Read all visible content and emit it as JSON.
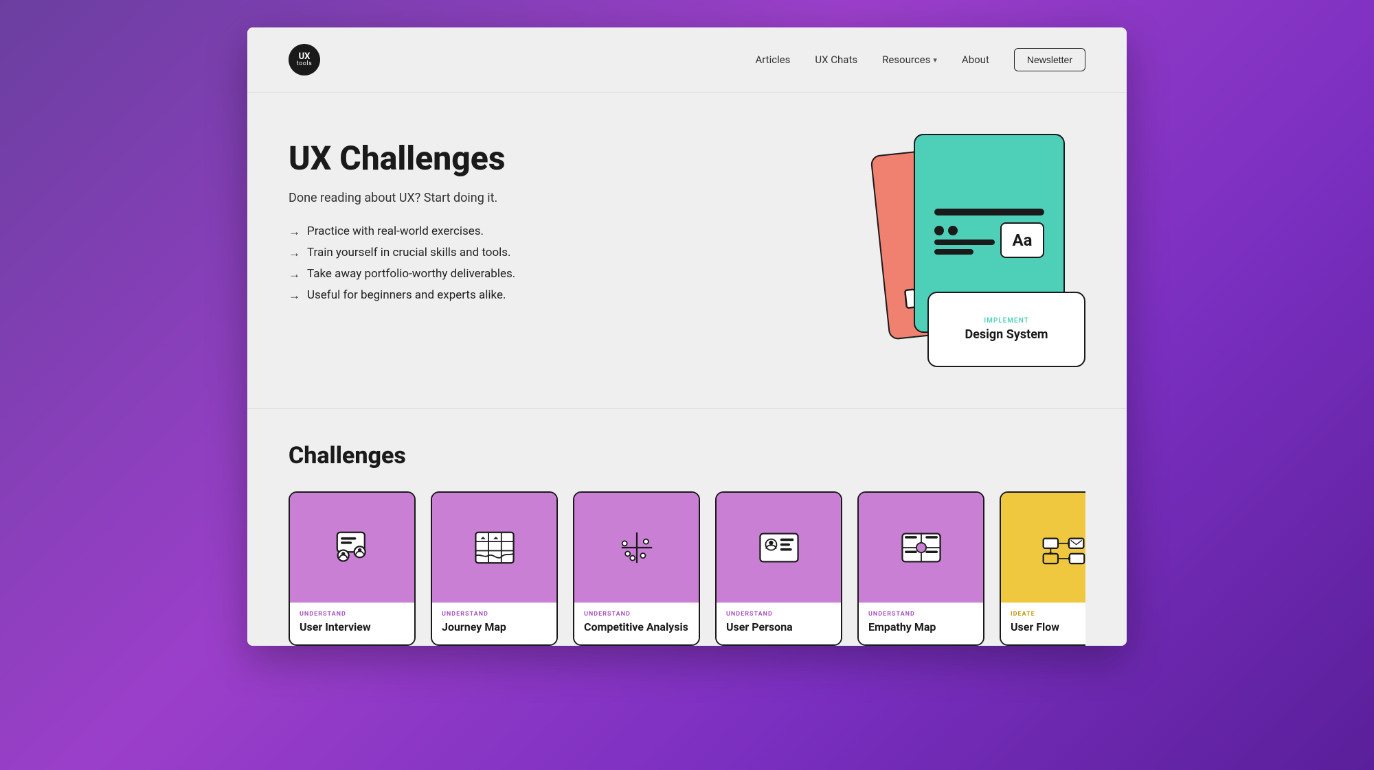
{
  "header": {
    "logo": {
      "ux": "UX",
      "tools": "tools"
    },
    "nav": {
      "articles": "Articles",
      "ux_chats": "UX Chats",
      "resources": "Resources",
      "about": "About",
      "newsletter": "Newsletter"
    }
  },
  "hero": {
    "title": "UX Challenges",
    "subtitle": "Done reading about UX? Start doing it.",
    "bullets": [
      "Practice with real-world exercises.",
      "Train yourself in crucial skills and tools.",
      "Take away portfolio-worthy deliverables.",
      "Useful for beginners and experts alike."
    ],
    "card_bottom_label": "IMPLEMENT",
    "card_bottom_title": "Design System"
  },
  "challenges": {
    "title": "Challenges",
    "cards": [
      {
        "id": 1,
        "color_class": "card-purple",
        "label": "UNDERSTAND",
        "label_color": "label-purple",
        "name": "User Interview"
      },
      {
        "id": 2,
        "color_class": "card-purple",
        "label": "UNDERSTAND",
        "label_color": "label-purple",
        "name": "Journey Map"
      },
      {
        "id": 3,
        "color_class": "card-purple",
        "label": "UNDERSTAND",
        "label_color": "label-purple",
        "name": "Competitive Analysis"
      },
      {
        "id": 4,
        "color_class": "card-purple",
        "label": "UNDERSTAND",
        "label_color": "label-purple",
        "name": "User Persona"
      },
      {
        "id": 5,
        "color_class": "card-purple",
        "label": "UNDERSTAND",
        "label_color": "label-purple",
        "name": "Empathy Map"
      },
      {
        "id": 6,
        "color_class": "card-yellow",
        "label": "IDEATE",
        "label_color": "label-yellow",
        "name": "User Flow"
      }
    ]
  }
}
